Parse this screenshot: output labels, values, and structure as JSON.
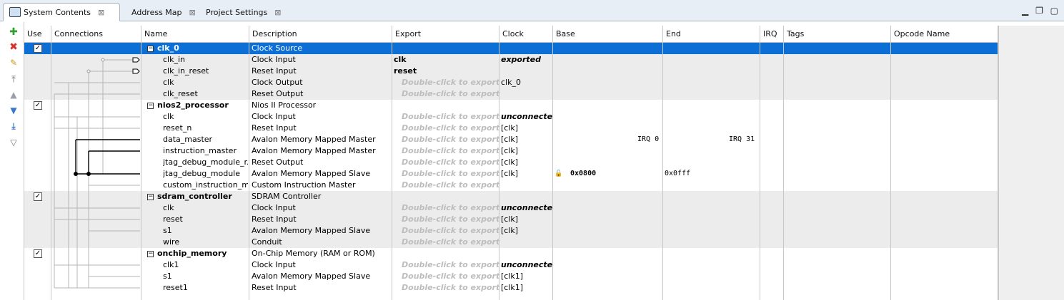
{
  "tabs": [
    {
      "label": "System Contents"
    },
    {
      "label": "Address Map"
    },
    {
      "label": "Project Settings"
    }
  ],
  "window_controls": [
    "minimize",
    "maximize",
    "restore"
  ],
  "toolbar_icons": [
    "add-icon",
    "remove-icon",
    "edit-icon",
    "move-top-icon",
    "move-up-icon",
    "move-down-icon",
    "move-bottom-icon",
    "filter-icon"
  ],
  "columns": {
    "use": "Use",
    "connections": "Connections",
    "name": "Name",
    "description": "Description",
    "export": "Export",
    "clock": "Clock",
    "base": "Base",
    "end": "End",
    "irq": "IRQ",
    "tags": "Tags",
    "opcode": "Opcode Name"
  },
  "rows": [
    {
      "name": "clk_0",
      "desc": "Clock Source",
      "export": "",
      "clock": "",
      "base": "",
      "end": "",
      "irq": "",
      "comp": true,
      "checked": true
    },
    {
      "name": "clk_in",
      "desc": "Clock Input",
      "export": "clk",
      "clock": "exported",
      "base": "",
      "end": "",
      "irq": ""
    },
    {
      "name": "clk_in_reset",
      "desc": "Reset Input",
      "export": "reset",
      "clock": "",
      "base": "",
      "end": "",
      "irq": ""
    },
    {
      "name": "clk",
      "desc": "Clock Output",
      "export": "Double-click to export",
      "clock": "clk_0",
      "base": "",
      "end": "",
      "irq": ""
    },
    {
      "name": "clk_reset",
      "desc": "Reset Output",
      "export": "Double-click to export",
      "clock": "",
      "base": "",
      "end": "",
      "irq": ""
    },
    {
      "name": "nios2_processor",
      "desc": "Nios II Processor",
      "export": "",
      "clock": "",
      "base": "",
      "end": "",
      "irq": "",
      "comp": true,
      "checked": true
    },
    {
      "name": "clk",
      "desc": "Clock Input",
      "export": "Double-click to export",
      "clock": "unconnected",
      "base": "",
      "end": "",
      "irq": ""
    },
    {
      "name": "reset_n",
      "desc": "Reset Input",
      "export": "Double-click to export",
      "clock": "[clk]",
      "base": "",
      "end": "",
      "irq": ""
    },
    {
      "name": "data_master",
      "desc": "Avalon Memory Mapped Master",
      "export": "Double-click to export",
      "clock": "[clk]",
      "base": "",
      "end": "IRQ 0",
      "irq": "IRQ 31"
    },
    {
      "name": "instruction_master",
      "desc": "Avalon Memory Mapped Master",
      "export": "Double-click to export",
      "clock": "[clk]",
      "base": "",
      "end": "",
      "irq": ""
    },
    {
      "name": "jtag_debug_module_r...",
      "desc": "Reset Output",
      "export": "Double-click to export",
      "clock": "[clk]",
      "base": "",
      "end": "",
      "irq": ""
    },
    {
      "name": "jtag_debug_module",
      "desc": "Avalon Memory Mapped Slave",
      "export": "Double-click to export",
      "clock": "[clk]",
      "base": "0x0800",
      "end": "0x0fff",
      "irq": ""
    },
    {
      "name": "custom_instruction_m...",
      "desc": "Custom Instruction Master",
      "export": "Double-click to export",
      "clock": "",
      "base": "",
      "end": "",
      "irq": ""
    },
    {
      "name": "sdram_controller",
      "desc": "SDRAM Controller",
      "export": "",
      "clock": "",
      "base": "",
      "end": "",
      "irq": "",
      "comp": true,
      "checked": true
    },
    {
      "name": "clk",
      "desc": "Clock Input",
      "export": "Double-click to export",
      "clock": "unconnected",
      "base": "",
      "end": "",
      "irq": ""
    },
    {
      "name": "reset",
      "desc": "Reset Input",
      "export": "Double-click to export",
      "clock": "[clk]",
      "base": "",
      "end": "",
      "irq": ""
    },
    {
      "name": "s1",
      "desc": "Avalon Memory Mapped Slave",
      "export": "Double-click to export",
      "clock": "[clk]",
      "base": "",
      "end": "",
      "irq": ""
    },
    {
      "name": "wire",
      "desc": "Conduit",
      "export": "Double-click to export",
      "clock": "",
      "base": "",
      "end": "",
      "irq": ""
    },
    {
      "name": "onchip_memory",
      "desc": "On-Chip Memory (RAM or ROM)",
      "export": "",
      "clock": "",
      "base": "",
      "end": "",
      "irq": "",
      "comp": true,
      "checked": true
    },
    {
      "name": "clk1",
      "desc": "Clock Input",
      "export": "Double-click to export",
      "clock": "unconnected",
      "base": "",
      "end": "",
      "irq": ""
    },
    {
      "name": "s1",
      "desc": "Avalon Memory Mapped Slave",
      "export": "Double-click to export",
      "clock": "[clk1]",
      "base": "",
      "end": "",
      "irq": ""
    },
    {
      "name": "reset1",
      "desc": "Reset Input",
      "export": "Double-click to export",
      "clock": "[clk1]",
      "base": "",
      "end": "",
      "irq": ""
    }
  ]
}
